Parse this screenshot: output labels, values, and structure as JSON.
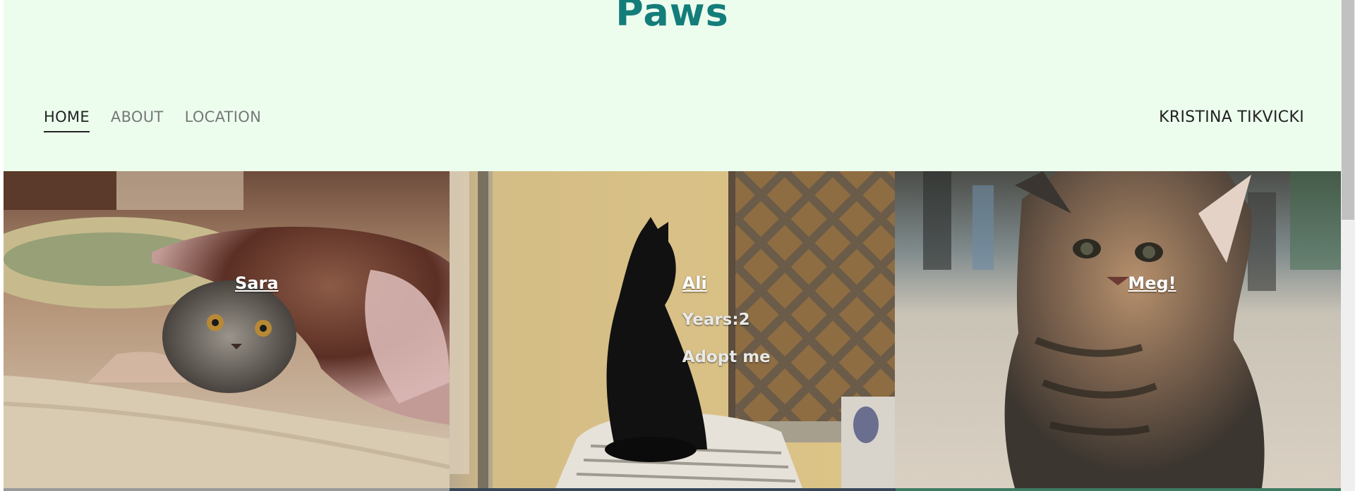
{
  "header": {
    "brand": "Paws",
    "nav": [
      "HOME",
      "ABOUT",
      "LOCATION"
    ],
    "active_nav": "HOME",
    "author": "KRISTINA TIKVICKI"
  },
  "cards": [
    {
      "name": "Sara"
    },
    {
      "name": "Ali",
      "years": "Years:2",
      "cta": "Adopt me"
    },
    {
      "name": "Meg!"
    }
  ],
  "colors": {
    "header_bg": "#ecfdee",
    "brand": "#147d7a"
  }
}
